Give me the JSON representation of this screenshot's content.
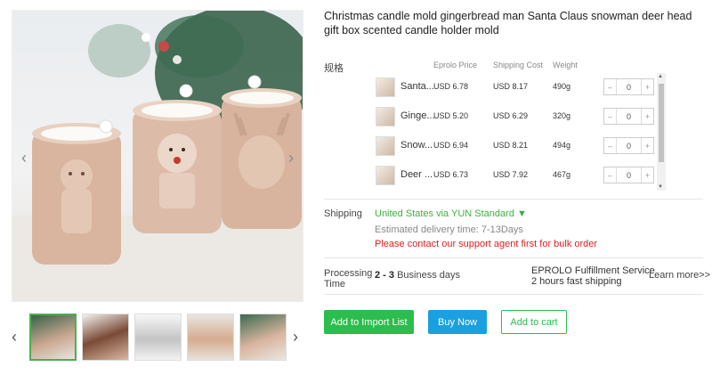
{
  "product": {
    "title": "Christmas candle mold gingerbread man Santa Claus snowman deer head gift box scented candle holder mold"
  },
  "gallery": {
    "main_image_alt": "",
    "thumbnails": [
      "",
      "",
      "",
      "",
      ""
    ],
    "active_thumbnail": 0
  },
  "variants": {
    "spec_label": "规格",
    "headers": {
      "price": "Eprolo Price",
      "shipping": "Shipping Cost",
      "weight": "Weight"
    },
    "rows": [
      {
        "name": "Santa...",
        "price": "USD 6.78",
        "shipping": "USD 8.17",
        "weight": "490g",
        "qty": "0"
      },
      {
        "name": "Ginge...",
        "price": "USD 5.20",
        "shipping": "USD 6.29",
        "weight": "320g",
        "qty": "0"
      },
      {
        "name": "Snow...",
        "price": "USD 6.94",
        "shipping": "USD 8.21",
        "weight": "494g",
        "qty": "0"
      },
      {
        "name": "Deer ...",
        "price": "USD 6.73",
        "shipping": "USD 7.92",
        "weight": "467g",
        "qty": "0"
      }
    ]
  },
  "shipping": {
    "label": "Shipping",
    "method": "United States via YUN Standard ▼",
    "estimate": "Estimated delivery time: 7-13Days",
    "warning": "Please contact our support agent first for bulk order"
  },
  "processing": {
    "label": "Processing Time",
    "days_bold": "2 - 3",
    "days_text": " Business days",
    "fulfillment_line1": "EPROLO Fulfillment Service",
    "fulfillment_line2": "2 hours fast shipping",
    "learn_more": "Learn more>>"
  },
  "actions": {
    "import": "Add to Import List",
    "buy": "Buy Now",
    "cart": "Add to cart"
  },
  "colors": {
    "accent_green": "#2bbd4e",
    "buy_blue": "#1aa0e0",
    "warning_red": "#e02020"
  }
}
